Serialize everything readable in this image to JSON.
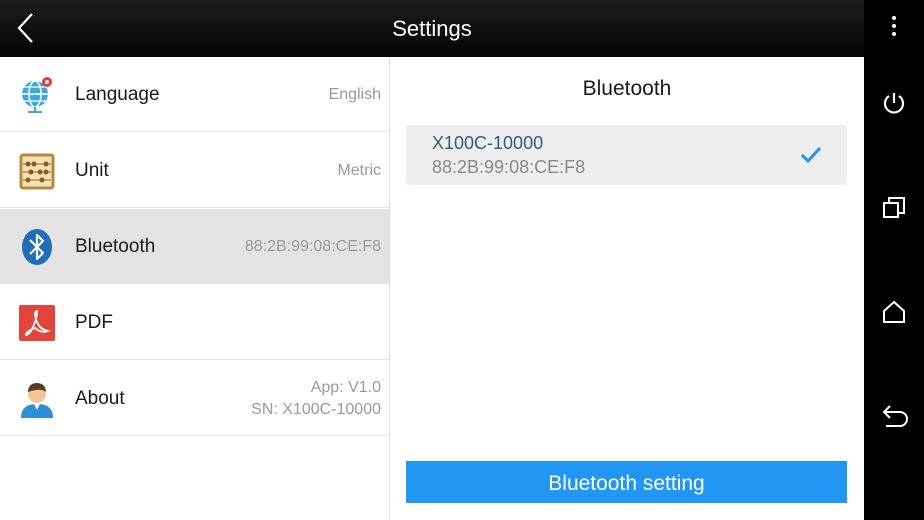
{
  "header": {
    "title": "Settings",
    "back_icon": "chevron-left-icon"
  },
  "settings": {
    "language": {
      "label": "Language",
      "value": "English",
      "icon": "globe-pin-icon"
    },
    "unit": {
      "label": "Unit",
      "value": "Metric",
      "icon": "abacus-icon"
    },
    "bluetooth": {
      "label": "Bluetooth",
      "value": "88:2B:99:08:CE:F8",
      "icon": "bluetooth-icon"
    },
    "pdf": {
      "label": "PDF",
      "icon": "pdf-icon"
    },
    "about": {
      "label": "About",
      "app_version": "App: V1.0",
      "serial": "SN: X100C-10000",
      "icon": "user-avatar-icon"
    }
  },
  "bluetooth_panel": {
    "title": "Bluetooth",
    "device": {
      "name": "X100C-10000",
      "mac": "88:2B:99:08:CE:F8",
      "connected": true
    },
    "setting_button": "Bluetooth setting"
  },
  "system_nav": [
    "more-vert-icon",
    "power-icon",
    "recents-icon",
    "home-icon",
    "back-icon"
  ],
  "colors": {
    "accent": "#2196f3",
    "selected_row": "#e3e3e3",
    "topbar": "#111111"
  }
}
